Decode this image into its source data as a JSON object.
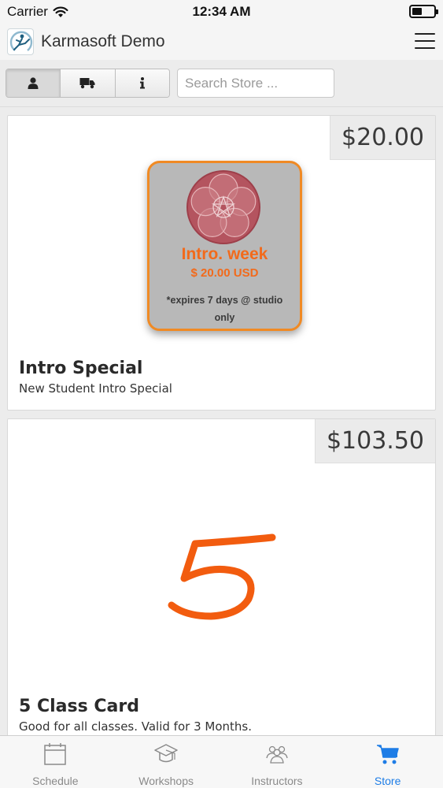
{
  "status_bar": {
    "carrier": "Carrier",
    "time": "12:34 AM"
  },
  "header": {
    "app_title": "Karmasoft Demo",
    "logo_icon": "yoga-logo-icon",
    "menu_icon": "hamburger-menu-icon"
  },
  "toolbar": {
    "segments": [
      {
        "icon": "user-icon",
        "active": true
      },
      {
        "icon": "truck-icon",
        "active": false
      },
      {
        "icon": "info-icon",
        "active": false
      }
    ],
    "search_placeholder": "Search Store ..."
  },
  "products": [
    {
      "price": "$20.00",
      "title": "Intro Special",
      "description": "New Student Intro Special",
      "image": {
        "title": "Intro. week",
        "price": "$ 20.00 USD",
        "note": "*expires 7 days @ studio only"
      }
    },
    {
      "price": "$103.50",
      "title": "5 Class Card",
      "description": "Good for all classes. Valid for 3 Months.",
      "image": {
        "numeral": "5"
      }
    }
  ],
  "tab_bar": {
    "accent": "#1e7de6",
    "inactive": "#8a8a8a",
    "tabs": [
      {
        "label": "Schedule",
        "icon": "calendar-icon",
        "active": false
      },
      {
        "label": "Workshops",
        "icon": "graduation-cap-icon",
        "active": false
      },
      {
        "label": "Instructors",
        "icon": "people-group-icon",
        "active": false
      },
      {
        "label": "Store",
        "icon": "shopping-cart-icon",
        "active": true
      }
    ]
  }
}
